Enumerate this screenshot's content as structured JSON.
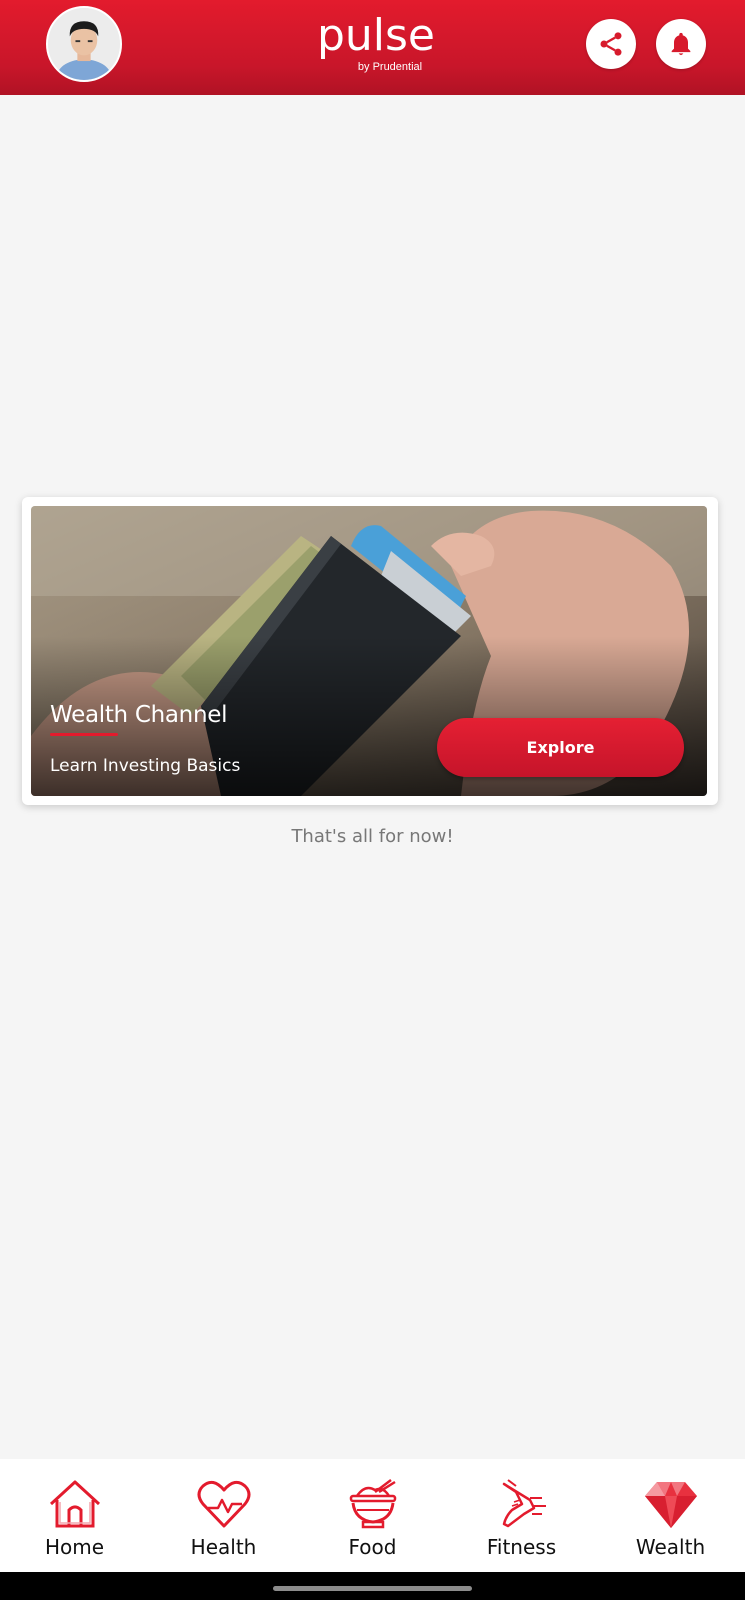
{
  "header": {
    "logo_text": "pulse",
    "logo_sub": "by Prudential",
    "avatar_icon": "user-avatar",
    "share_icon": "share-icon",
    "bell_icon": "bell-icon",
    "brand_color": "#e31b2d"
  },
  "card": {
    "title": "Wealth Channel",
    "subtitle": "Learn Investing Basics",
    "button_label": "Explore",
    "image_icon": "wallet-photo"
  },
  "end_text": "That's all for now!",
  "nav": {
    "items": [
      {
        "label": "Home",
        "icon": "home-icon"
      },
      {
        "label": "Health",
        "icon": "heart-icon"
      },
      {
        "label": "Food",
        "icon": "bowl-icon"
      },
      {
        "label": "Fitness",
        "icon": "running-shoe-icon"
      },
      {
        "label": "Wealth",
        "icon": "diamond-icon"
      }
    ]
  }
}
